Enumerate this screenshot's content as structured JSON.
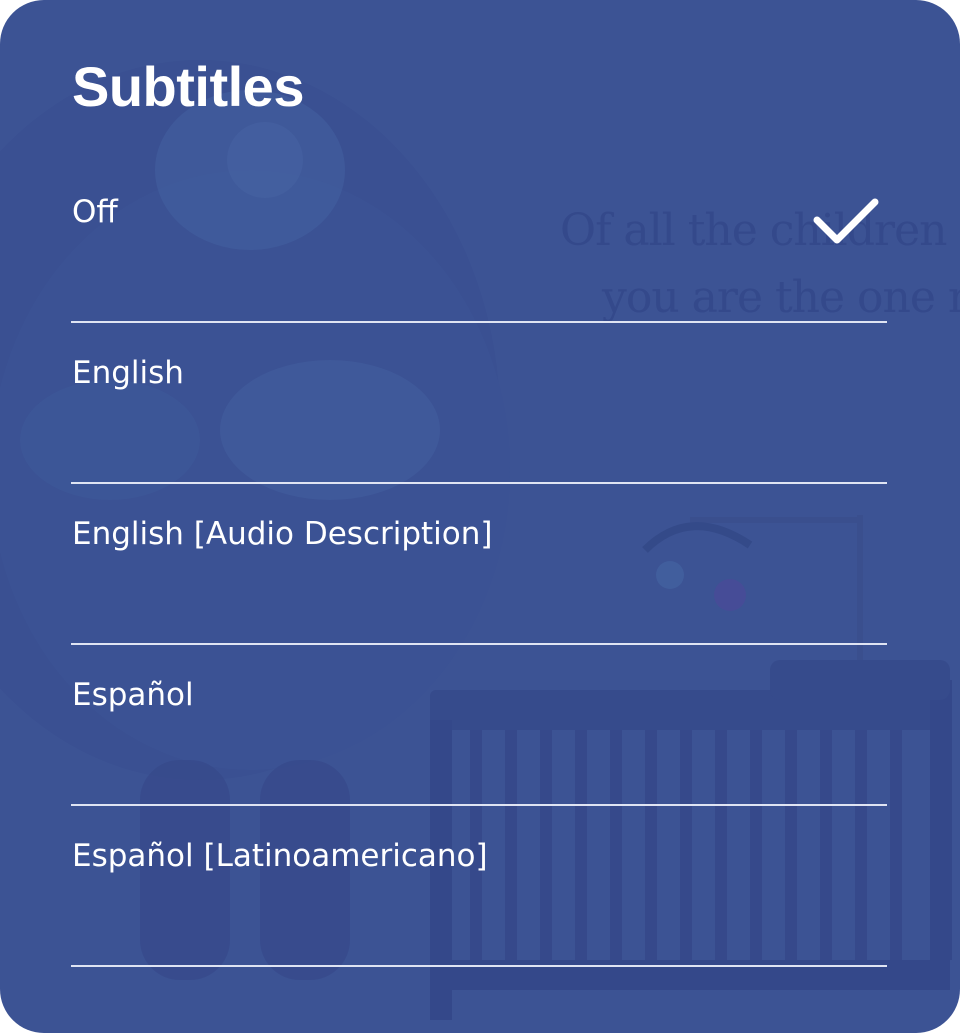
{
  "panel": {
    "title": "Subtitles"
  },
  "background": {
    "text_line_1": "Of all the children t",
    "text_line_2": "you are the one n"
  },
  "options": [
    {
      "label": "Off",
      "selected": true
    },
    {
      "label": "English",
      "selected": false
    },
    {
      "label": "English [Audio Description]",
      "selected": false
    },
    {
      "label": "Español",
      "selected": false
    },
    {
      "label": "Español [Latinoamericano]",
      "selected": false
    }
  ],
  "icons": {
    "selected": "check-icon"
  },
  "colors": {
    "panel_background": "#3c5394",
    "text": "#ffffff",
    "divider": "#dfe4f3"
  }
}
